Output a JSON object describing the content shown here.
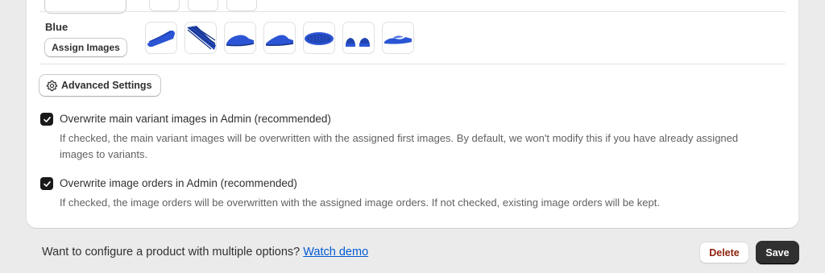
{
  "variant": {
    "name": "Blue",
    "assign_label": "Assign Images",
    "images": [
      {
        "icon": "slide-sandal-angle-icon"
      },
      {
        "icon": "slide-sandal-stack-icon"
      },
      {
        "icon": "slide-sandal-side-icon"
      },
      {
        "icon": "slide-sandal-side-alt-icon"
      },
      {
        "icon": "slide-sandal-sole-icon"
      },
      {
        "icon": "slide-sandal-pair-icon"
      },
      {
        "icon": "slide-sandal-lowside-icon"
      }
    ]
  },
  "advanced": {
    "label": "Advanced Settings"
  },
  "options": [
    {
      "checked": true,
      "label": "Overwrite main variant images in Admin (recommended)",
      "help": "If checked, the main variant images will be overwritten with the assigned first images. By default, we won't modify this if you have already assigned images to variants."
    },
    {
      "checked": true,
      "label": "Overwrite image orders in Admin (recommended)",
      "help": "If checked, the image orders will be overwritten with the assigned image orders. If not checked, existing image orders will be kept."
    }
  ],
  "footer": {
    "prompt": "Want to configure a product with multiple options? ",
    "link": "Watch demo",
    "delete_label": "Delete",
    "save_label": "Save"
  },
  "colors": {
    "product_blue": "#2b55d4",
    "link": "#005bd3",
    "primary_button": "#303030",
    "destructive_text": "#8e1f0b"
  }
}
